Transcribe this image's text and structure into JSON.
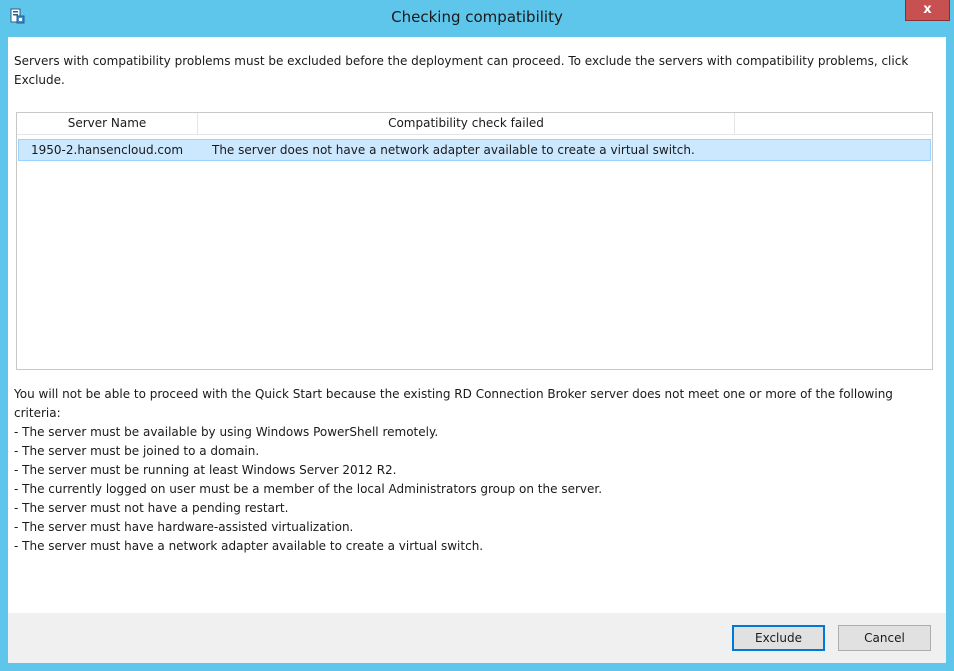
{
  "window": {
    "title": "Checking compatibility",
    "close_label": "x",
    "app_icon": "server-manager-icon"
  },
  "intro_text": "Servers with compatibility problems must be excluded before the deployment can proceed. To exclude the servers with compatibility problems, click Exclude.",
  "table": {
    "columns": [
      "Server Name",
      "Compatibility check failed",
      ""
    ],
    "rows": [
      {
        "server_name": "1950-2.hansencloud.com",
        "check_failed": "The server does not have a network adapter available to create a virtual switch."
      }
    ]
  },
  "criteria": {
    "intro": "You will not be able to proceed with the Quick Start because the existing RD Connection Broker server does not meet one or more of the following criteria:",
    "items": [
      "- The server must be available by using Windows PowerShell remotely.",
      "- The server must be joined to a domain.",
      "- The server must be running at least Windows Server 2012 R2.",
      "- The currently logged on user must be a member of the local Administrators group on the server.",
      "- The server must not have a pending restart.",
      "- The server must have hardware-assisted virtualization.",
      "- The server must have a network adapter available to create a virtual switch."
    ]
  },
  "buttons": {
    "exclude_label": "Exclude",
    "cancel_label": "Cancel"
  },
  "colors": {
    "title_bar": "#5ec6ea",
    "close_button": "#c75050",
    "selected_row": "#cce8ff",
    "default_button_border": "#0078d7"
  }
}
